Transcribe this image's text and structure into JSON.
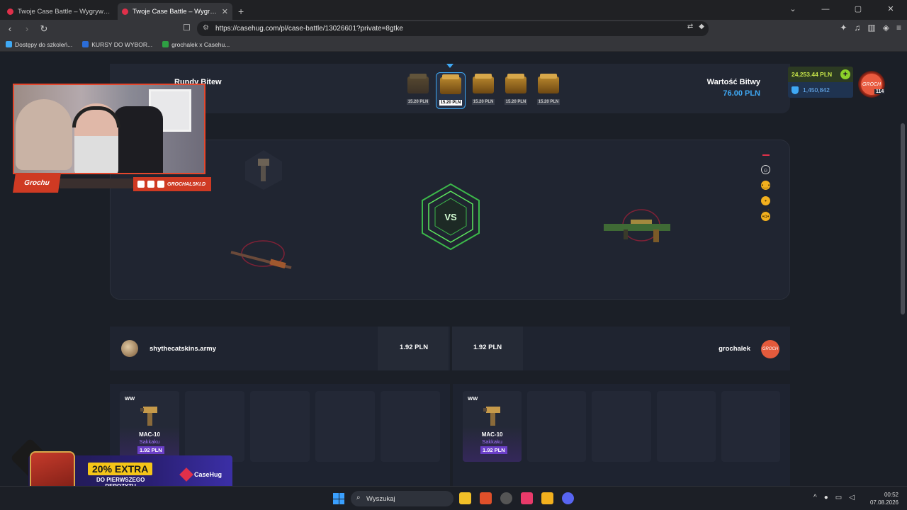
{
  "browser": {
    "tabs": [
      {
        "label": "Twoje Case Battle – Wygrywaj skiny C"
      },
      {
        "label": "Twoje Case Battle – Wygrywaj sk"
      }
    ],
    "url": "https://casehug.com/pl/case-battle/13026601?private=8gtke",
    "bookmarks": [
      {
        "label": "Dostępy do szkoleń...",
        "color": "#3fa9f5"
      },
      {
        "label": "KURSY DO WYBOR...",
        "color": "#2b6dd8"
      },
      {
        "label": "grochalek x Casehu...",
        "color": "#2ea043"
      }
    ]
  },
  "header": {
    "rounds_title": "Rundy Bitew",
    "value_title": "Wartość Bitwy",
    "value_amount": "76.00 PLN",
    "cases": [
      {
        "price": "15.20 PLN",
        "state": "past"
      },
      {
        "price": "15.20 PLN",
        "state": "active"
      },
      {
        "price": "15.20 PLN",
        "state": "upcoming"
      },
      {
        "price": "15.20 PLN",
        "state": "upcoming"
      },
      {
        "price": "15.20 PLN",
        "state": "upcoming"
      }
    ],
    "balance": "24,253.44 PLN",
    "points": "1,450,842",
    "avatar_text": "GROCH",
    "level": "114"
  },
  "arena": {
    "vs_label": "VS",
    "emotes": [
      "smile-icon",
      "neutral-face-icon",
      "sad-face-icon",
      "surprised-face-icon"
    ]
  },
  "players": {
    "left": {
      "name": "shythecatskins.army",
      "value": "1.92 PLN"
    },
    "right": {
      "name": "grochalek",
      "value": "1.92 PLN",
      "avatar_text": "GROCH"
    }
  },
  "drops": {
    "left": {
      "ww": "WW",
      "name": "MAC-10",
      "skin": "Sakkaku",
      "price": "1.92 PLN"
    },
    "right": {
      "ww": "WW",
      "name": "MAC-10",
      "skin": "Sakkaku",
      "price": "1.92 PLN"
    }
  },
  "overlay": {
    "cam_logo": "Grochu",
    "socials_handle": "GROCHALSKI.D",
    "promo_pct": "20% EXTRA",
    "promo_sub_1": "DO PIERWSZEGO",
    "promo_sub_2": "DEPOZYTU",
    "promo_brand": "CaseHug"
  },
  "taskbar": {
    "search": "Wyszukaj",
    "time": "00:52",
    "date": "07.08.2026"
  },
  "colors": {
    "accent": "#3fa9f5",
    "brand_red": "#e0304a",
    "vs_green": "#5ee85e",
    "purple": "#6b3fc8"
  }
}
